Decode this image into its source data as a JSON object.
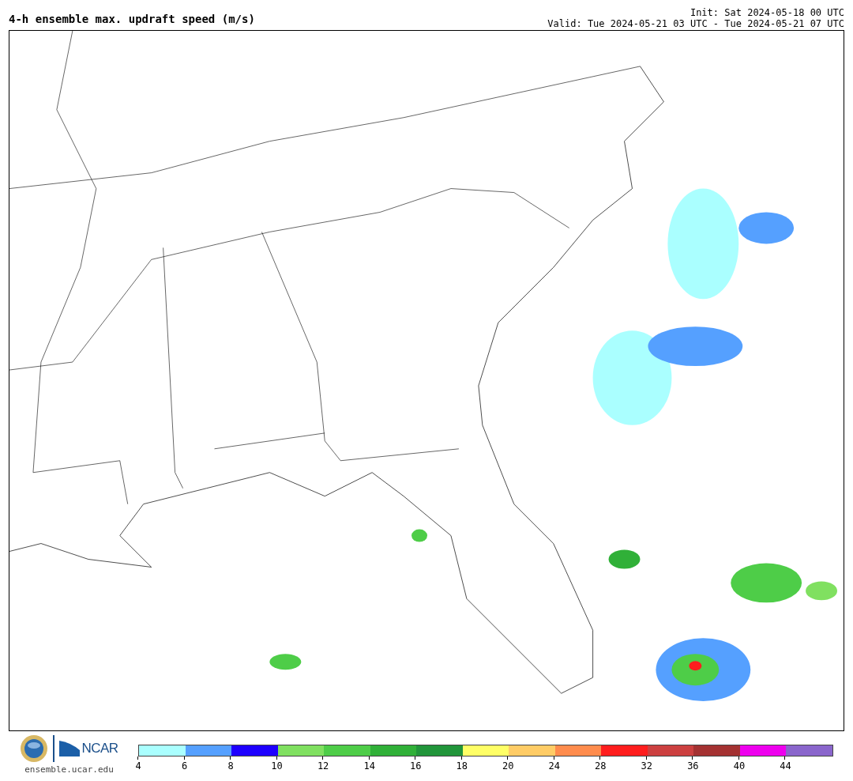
{
  "header": {
    "title": "4-h ensemble max. updraft speed (m/s)",
    "init": "Init: Sat 2024-05-18 00 UTC",
    "valid": "Valid: Tue 2024-05-21 03 UTC - Tue 2024-05-21 07 UTC"
  },
  "footer": {
    "logo_text": "NCAR",
    "site": "ensemble.ucar.edu"
  },
  "legend": {
    "bins": [
      {
        "label": "4",
        "color": "#aaffff"
      },
      {
        "label": "6",
        "color": "#55a0ff"
      },
      {
        "label": "8",
        "color": "#1e00ff"
      },
      {
        "label": "10",
        "color": "#80e060"
      },
      {
        "label": "12",
        "color": "#4ecd48"
      },
      {
        "label": "14",
        "color": "#30b038"
      },
      {
        "label": "16",
        "color": "#21953a"
      },
      {
        "label": "18",
        "color": "#ffff66"
      },
      {
        "label": "20",
        "color": "#ffcc66"
      },
      {
        "label": "24",
        "color": "#ff8c4d"
      },
      {
        "label": "28",
        "color": "#ff1e1e"
      },
      {
        "label": "32",
        "color": "#cc4040"
      },
      {
        "label": "36",
        "color": "#a43232"
      },
      {
        "label": "40",
        "color": "#ee00ee"
      },
      {
        "label": "44",
        "color": "#8a66cc"
      }
    ]
  }
}
